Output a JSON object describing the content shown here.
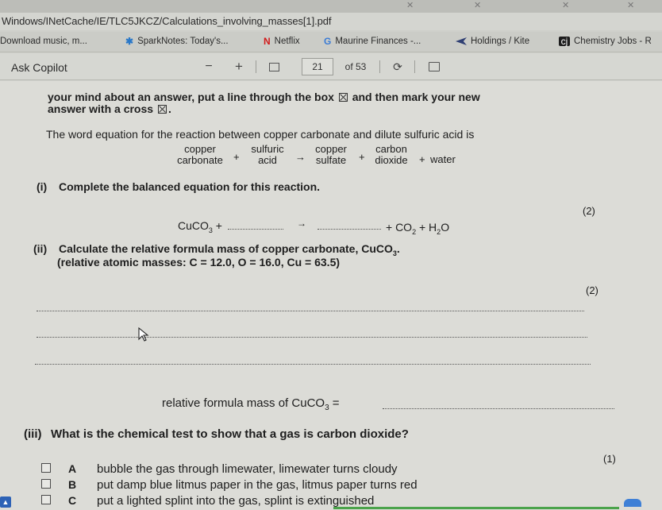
{
  "browser": {
    "url": "Windows/INetCache/IE/TLC5JKCZ/Calculations_involving_masses[1].pdf",
    "bookmarks": [
      {
        "label": "Download music, m...",
        "icon": "none"
      },
      {
        "label": "SparkNotes: Today's...",
        "icon": "sparknotes-icon"
      },
      {
        "label": "Netflix",
        "icon": "netflix-icon"
      },
      {
        "label": "Maurine Finances -...",
        "icon": "google-icon"
      },
      {
        "label": "Holdings / Kite",
        "icon": "kite-icon"
      },
      {
        "label": "Chemistry Jobs - R",
        "icon": "chemistry-icon"
      }
    ]
  },
  "toolbar": {
    "copilot_label": "Ask Copilot",
    "zoom_out": "−",
    "zoom_in": "+",
    "page_number": "21",
    "page_total": "of 53"
  },
  "pdf": {
    "intro_line1": "your mind about an answer, put a line through the box",
    "intro_line1_tail": "and then mark your new",
    "intro_line2": "answer with a cross",
    "word_eq_intro": "The word equation for the reaction between copper carbonate and dilute sulfuric acid is",
    "word_eq": {
      "term1_a": "copper",
      "term1_b": "carbonate",
      "term2_a": "sulfuric",
      "term2_b": "acid",
      "term3_a": "copper",
      "term3_b": "sulfate",
      "term4_a": "carbon",
      "term4_b": "dioxide",
      "term5": "water"
    },
    "q1_label": "(i)",
    "q1_text": "Complete the balanced equation for this reaction.",
    "q1_marks": "(2)",
    "q2_label": "(ii)",
    "q2_text": "Calculate the relative formula mass of copper carbonate, CuCO",
    "q2_text_tail": ".",
    "q2_masses": "(relative atomic masses: C = 12.0, O = 16.0, Cu = 63.5)",
    "q2_marks": "(2)",
    "q2_answer_label": "relative formula mass of CuCO",
    "q2_answer_tail": " =",
    "q3_label": "(iii)",
    "q3_text": "What is the chemical test to show that a gas is carbon dioxide?",
    "q3_marks": "(1)",
    "options": [
      {
        "letter": "A",
        "text": "bubble the gas through limewater, limewater turns cloudy"
      },
      {
        "letter": "B",
        "text": "put damp blue litmus paper in the gas, litmus paper turns red"
      },
      {
        "letter": "C",
        "text": "put a lighted splint into the gas, splint is extinguished"
      }
    ]
  }
}
